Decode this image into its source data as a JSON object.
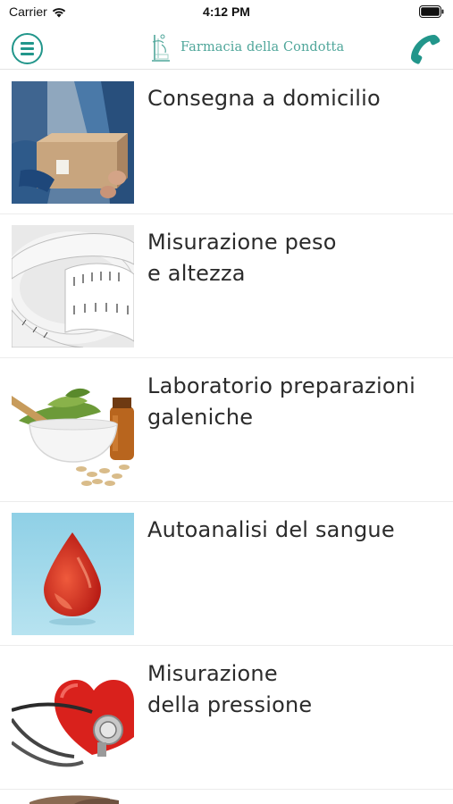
{
  "status_bar": {
    "carrier": "Carrier",
    "time": "4:12 PM"
  },
  "header": {
    "brand_name": "Farmacia della Condotta",
    "menu_icon": "hamburger-menu-icon",
    "phone_icon": "phone-icon",
    "accent_color": "#22968b"
  },
  "services": [
    {
      "title_lines": [
        "Consegna a domicilio"
      ],
      "image": "home-delivery-photo"
    },
    {
      "title_lines": [
        "Misurazione peso",
        "e altezza"
      ],
      "image": "measuring-tape-photo"
    },
    {
      "title_lines": [
        "Laboratorio preparazioni",
        "galeniche"
      ],
      "image": "mortar-herbs-photo"
    },
    {
      "title_lines": [
        "Autoanalisi del sangue"
      ],
      "image": "blood-drop-photo"
    },
    {
      "title_lines": [
        "Misurazione",
        "della pressione"
      ],
      "image": "heart-stethoscope-photo"
    }
  ]
}
